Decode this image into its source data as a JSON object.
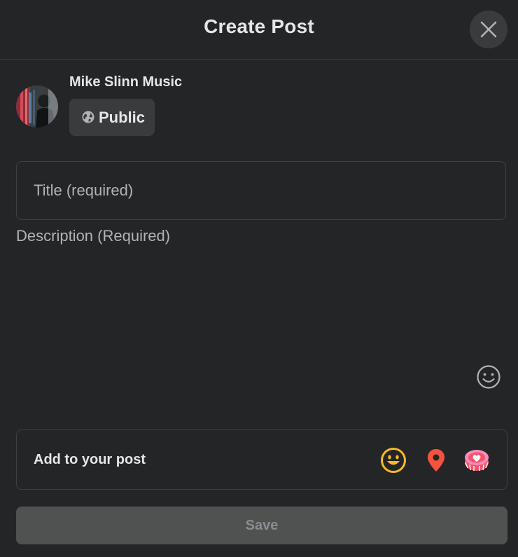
{
  "dialog": {
    "title": "Create Post"
  },
  "author": {
    "name": "Mike Slinn Music",
    "privacy_label": "Public"
  },
  "form": {
    "title_placeholder": "Title (required)",
    "description_placeholder": "Description (Required)"
  },
  "add_to_post": {
    "label": "Add to your post",
    "icons": [
      "feeling-icon",
      "location-icon",
      "life-event-icon"
    ]
  },
  "actions": {
    "save_label": "Save"
  },
  "colors": {
    "background": "#242526",
    "surface": "#3a3b3c",
    "text": "#e4e6eb",
    "muted_text": "#b0b3b8",
    "feeling": "#f7b928",
    "location": "#f5533d",
    "life_event": "#f35369",
    "save_disabled_bg": "#505151",
    "save_disabled_text": "#8a8d91"
  }
}
